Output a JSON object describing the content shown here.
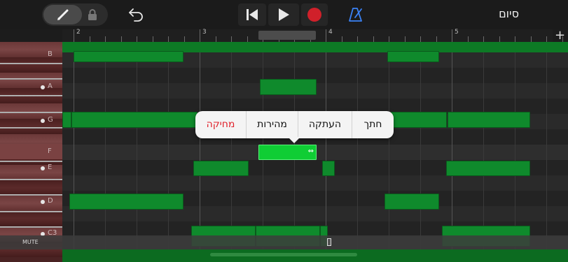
{
  "toolbar": {
    "done_label": "סיום",
    "icons": [
      "pencil-icon",
      "lock-icon",
      "undo-icon",
      "go-to-start-icon",
      "play-icon",
      "record-icon",
      "metronome-icon"
    ],
    "record_color": "#d0202a",
    "metronome_color": "#3b82f6"
  },
  "ruler": {
    "bars": [
      "2",
      "3",
      "4",
      "5"
    ],
    "add_label": "+"
  },
  "keys": {
    "labels": [
      "B",
      "A",
      "G",
      "F",
      "E",
      "D",
      "C3"
    ]
  },
  "context_menu": {
    "items": [
      "חתך",
      "העתקה",
      "מהירות",
      "מחיקה"
    ],
    "delete_color": "#e0202a"
  },
  "bottom": {
    "mute_label": "MUTE"
  },
  "colors": {
    "note": "#0f8a2c",
    "note_selected": "#0fcd34",
    "keys_bg": "#4a2323"
  }
}
